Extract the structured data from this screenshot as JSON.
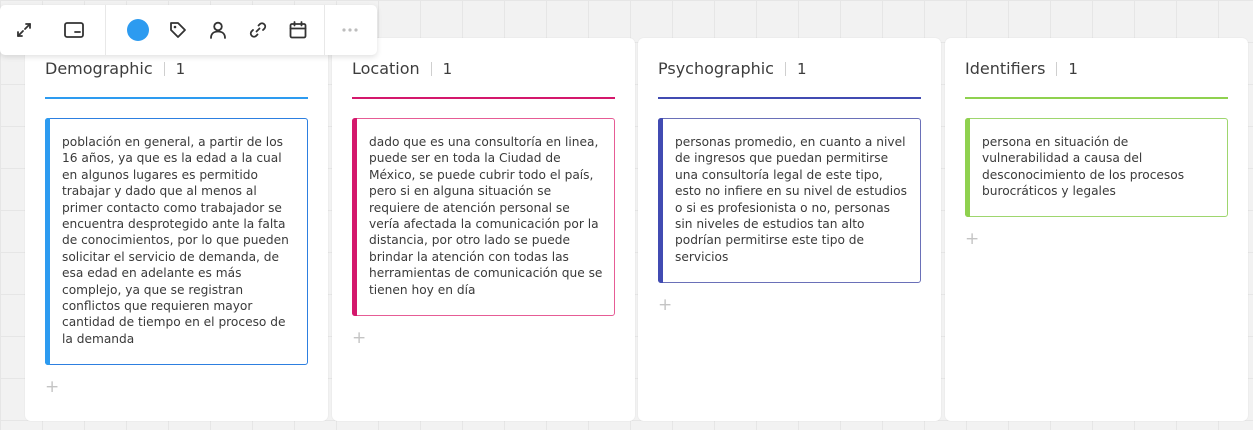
{
  "toolbar": {
    "buttons": [
      {
        "icon": "expand-icon"
      },
      {
        "icon": "card-icon"
      },
      {
        "icon": "color-dot",
        "color": "#2d9bf0"
      },
      {
        "icon": "tag-icon"
      },
      {
        "icon": "user-icon"
      },
      {
        "icon": "link-icon"
      },
      {
        "icon": "calendar-icon"
      },
      {
        "icon": "more-icon"
      }
    ]
  },
  "columns": [
    {
      "title": "Demographic",
      "count": "1",
      "color": "#2d9bf0",
      "card_text": "población en general, a partir de los 16 años, ya que es la edad a la cual en algunos lugares es permitido trabajar y dado que al menos al primer contacto como trabajador se encuentra desprotegido ante la falta de conocimientos, por lo que pueden solicitar el servicio de demanda, de esa edad en adelante es más complejo, ya que se registran conflictos que requieren mayor cantidad de tiempo en el proceso de la demanda",
      "add_label": "+"
    },
    {
      "title": "Location",
      "count": "1",
      "color": "#d4186c",
      "card_text": "dado que es una consultoría en linea, puede ser en toda la Ciudad de México, se puede cubrir todo el país, pero si en alguna situación se requiere de atención personal se vería afectada la comunicación por la distancia, por otro lado se puede brindar la atención con todas las herramientas de comunicación que se tienen hoy en día",
      "add_label": "+"
    },
    {
      "title": "Psychographic",
      "count": "1",
      "color": "#414bb2",
      "card_text": "personas promedio, en cuanto a nivel de ingresos que puedan permitirse una consultoría legal de este tipo, esto no infiere en su nivel de estudios o si es profesionista o no, personas sin niveles de estudios tan alto podrían permitirse este tipo de servicios",
      "add_label": "+"
    },
    {
      "title": "Identifiers",
      "count": "1",
      "color": "#8fd14f",
      "card_text": "persona en situación de vulnerabilidad a causa del desconocimiento de  los procesos burocráticos y legales",
      "add_label": "+"
    }
  ]
}
